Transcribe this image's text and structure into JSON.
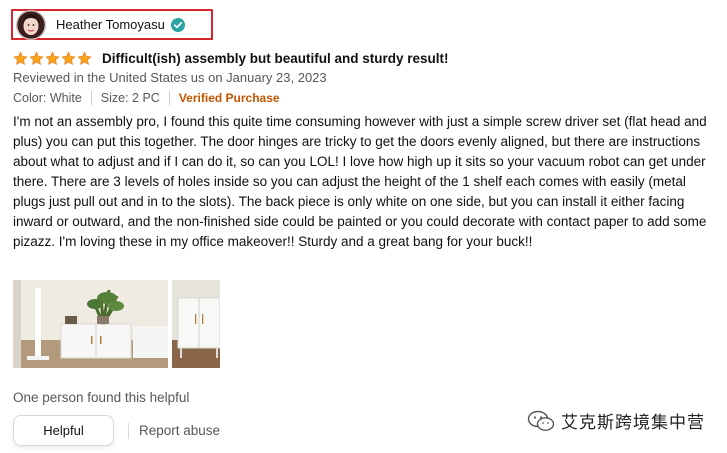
{
  "review": {
    "reviewer_name": "Heather Tomoyasu",
    "rating": 5,
    "max_rating": 5,
    "title": "Difficult(ish) assembly but beautiful and sturdy result!",
    "review_date": "Reviewed in the United States us on January 23, 2023",
    "color_label": "Color: White",
    "size_label": "Size: 2 PC",
    "verified_label": "Verified Purchase",
    "body": "I'm not an assembly pro, I found this quite time consuming however with just a simple screw driver set (flat head and plus) you can put this together. The door hinges are tricky to get the doors evenly aligned, but there are instructions about what to adjust and if I can do it, so can you LOL! I love how high up it sits so your vacuum robot can get under there. There are 3 levels of holes inside so you can adjust the height of the 1 shelf each comes with easily (metal plugs just pull out and in to the slots). The back piece is only white on one side, but you can install it either facing inward or outward, and the non-finished side could be painted or you could decorate with contact paper to add some pizazz. I'm loving these in my office makeover!! Sturdy and a great bang for your buck!!",
    "helpful_count_text": "One person found this helpful",
    "helpful_button": "Helpful",
    "report_abuse": "Report abuse"
  },
  "watermark": {
    "text": "艾克斯跨境集中营"
  },
  "colors": {
    "star": "#ffa41c",
    "verified_purchase": "#c45500",
    "highlight_box": "#d9262c",
    "secondary_text": "#565959"
  },
  "icons": {
    "verified": "verified-check-icon",
    "star": "star-icon",
    "watermark_logo": "wechat-logo-icon"
  }
}
